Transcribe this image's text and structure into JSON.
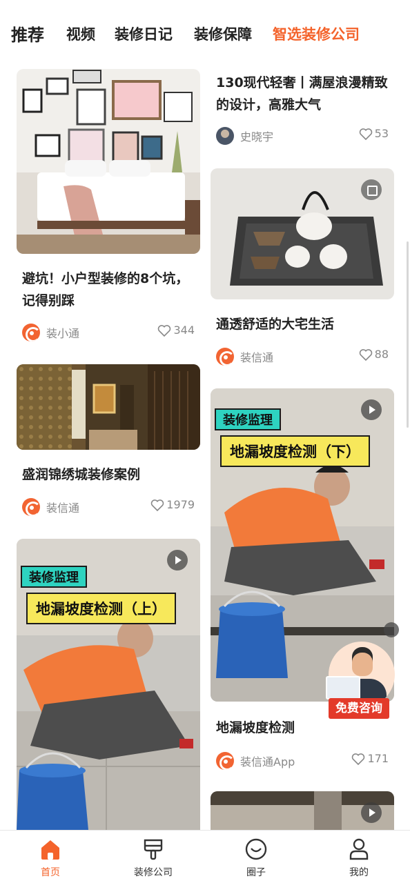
{
  "tabs": [
    {
      "label": "推荐",
      "active": true
    },
    {
      "label": "视频"
    },
    {
      "label": "装修日记"
    },
    {
      "label": "装修保障"
    },
    {
      "label": "智选装修公司",
      "accent": true
    }
  ],
  "colors": {
    "accent": "#f4632b",
    "text": "#222222",
    "muted": "#888888",
    "tag_teal": "#2ed3c0",
    "headline_yellow": "#f7e85b",
    "consult_red": "#e33a2a"
  },
  "feed": {
    "left": [
      {
        "title": "避坑！小户型装修的8个坑，记得别踩",
        "author": "装小通",
        "likes": "344",
        "badge": "none"
      },
      {
        "title": "盛润锦绣城装修案例",
        "author": "装信通",
        "likes": "1979",
        "badge": "none"
      },
      {
        "title": "",
        "author": "",
        "likes": "",
        "badge": "play-icon",
        "tag": "装修监理",
        "headline": "地漏坡度检测（上）"
      }
    ],
    "right": [
      {
        "title": "130现代轻奢丨满屋浪漫精致的设计，高雅大气",
        "author": "史晓宇",
        "likes": "53",
        "badge": "none"
      },
      {
        "title": "通透舒适的大宅生活",
        "author": "装信通",
        "likes": "88",
        "badge": "album-icon"
      },
      {
        "title": "地漏坡度检测",
        "author": "装信通App",
        "likes": "171",
        "badge": "play-icon",
        "tag": "装修监理",
        "headline": "地漏坡度检测（下）"
      },
      {
        "title": "",
        "author": "",
        "likes": "",
        "badge": "play-icon"
      }
    ]
  },
  "consult": {
    "label": "免费咨询"
  },
  "bottom_nav": [
    {
      "label": "首页",
      "icon": "home-icon",
      "active": true
    },
    {
      "label": "装修公司",
      "icon": "brush-icon"
    },
    {
      "label": "圈子",
      "icon": "smile-circle-icon"
    },
    {
      "label": "我的",
      "icon": "user-icon"
    }
  ]
}
